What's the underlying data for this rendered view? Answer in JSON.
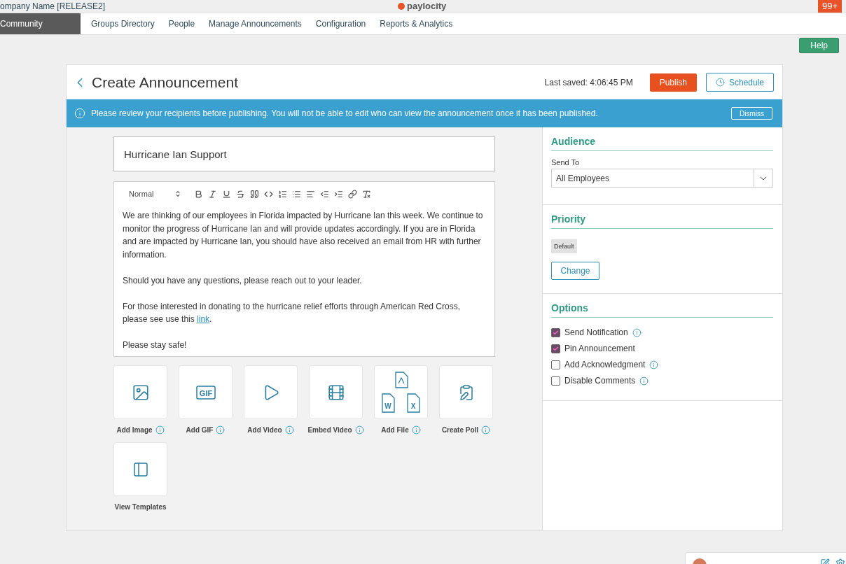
{
  "top_bar": {
    "company": "ompany Name [RELEASE2]",
    "logo": "paylocity",
    "badge": "99+"
  },
  "nav": [
    {
      "label": "Community",
      "selected": true
    },
    {
      "label": "Groups Directory",
      "selected": false
    },
    {
      "label": "People",
      "selected": false
    },
    {
      "label": "Manage Announcements",
      "selected": false
    },
    {
      "label": "Configuration",
      "selected": false
    },
    {
      "label": "Reports & Analytics",
      "selected": false
    }
  ],
  "help_button": "Help",
  "header": {
    "title": "Create Announcement",
    "last_saved": "Last saved: 4:06:45 PM",
    "publish": "Publish",
    "schedule": "Schedule"
  },
  "banner": {
    "message": "Please review your recipients before publishing. You will not be able to edit who can view the announcement once it has been published.",
    "dismiss": "Dismiss"
  },
  "editor": {
    "title_value": "Hurricane Ian Support",
    "block_format": "Normal",
    "paragraphs": [
      {
        "text": "We are thinking of our employees in Florida impacted by Hurricane Ian this week. We continue to monitor the progress of Hurricane Ian and will provide updates accordingly. If you are in Florida and are impacted by Hurricane Ian, you should have also received an email from HR with further information."
      },
      {
        "text": "Should you have any questions, please reach out to your leader."
      },
      {
        "text": "For those interested in donating to the hurricane relief efforts through American Red Cross, please see use this ",
        "link": "link",
        "after": "."
      },
      {
        "text": "Please stay safe!"
      }
    ]
  },
  "attachments": [
    {
      "kind": "image",
      "label": "Add Image",
      "info": true
    },
    {
      "kind": "gif",
      "label": "Add GIF",
      "info": true,
      "icon_text": "GIF"
    },
    {
      "kind": "video",
      "label": "Add Video",
      "info": true
    },
    {
      "kind": "embed",
      "label": "Embed Video",
      "info": true
    },
    {
      "kind": "file",
      "label": "Add File",
      "info": true,
      "icon_letters": [
        "W",
        "X"
      ]
    },
    {
      "kind": "poll",
      "label": "Create Poll",
      "info": true
    },
    {
      "kind": "templates",
      "label": "View Templates",
      "info": false
    }
  ],
  "audience": {
    "title": "Audience",
    "send_to_label": "Send To",
    "send_to_value": "All Employees"
  },
  "priority": {
    "title": "Priority",
    "value": "Default",
    "change": "Change"
  },
  "options": {
    "title": "Options",
    "items": [
      {
        "label": "Send Notification",
        "checked": true,
        "info": true
      },
      {
        "label": "Pin Announcement",
        "checked": true,
        "info": false
      },
      {
        "label": "Add Acknowledgment",
        "checked": false,
        "info": true
      },
      {
        "label": "Disable Comments",
        "checked": false,
        "info": true
      }
    ]
  }
}
